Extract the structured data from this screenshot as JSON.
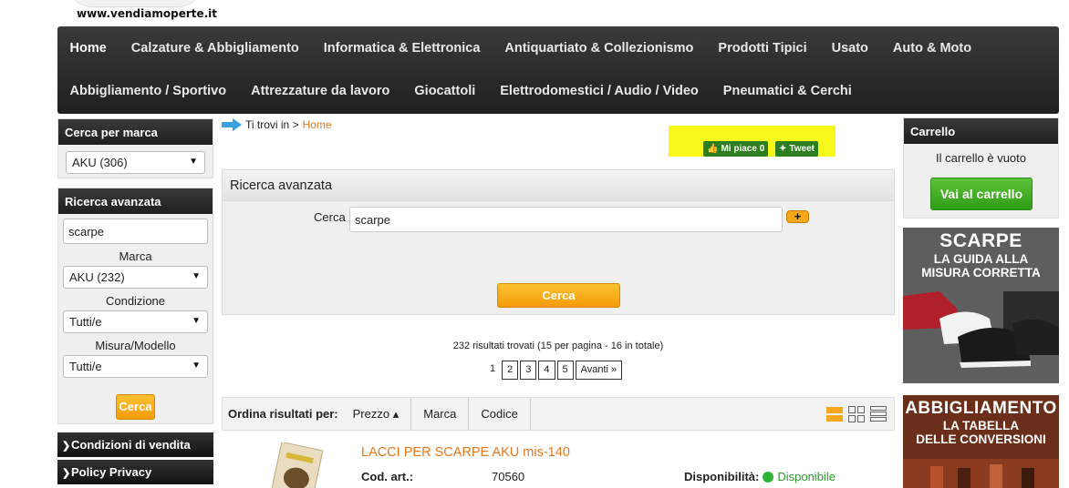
{
  "site": {
    "url": "www.vendiamoperte.it"
  },
  "nav": {
    "row1": [
      "Home",
      "Calzature & Abbigliamento",
      "Informatica & Elettronica",
      "Antiquartiato & Collezionismo",
      "Prodotti Tipici",
      "Usato",
      "Auto & Moto"
    ],
    "row2": [
      "Abbigliamento / Sportivo",
      "Attrezzature da lavoro",
      "Giocattoli",
      "Elettrodomestici / Audio / Video",
      "Pneumatici & Cerchi"
    ]
  },
  "brand_box": {
    "title": "Cerca per marca",
    "selected": "AKU (306)"
  },
  "adv_side": {
    "title": "Ricerca avanzata",
    "query": "scarpe",
    "marca_label": "Marca",
    "marca_value": "AKU (232)",
    "condizione_label": "Condizione",
    "condizione_value": "Tutti/e",
    "misura_label": "Misura/Modello",
    "misura_value": "Tutti/e",
    "button": "Cerca"
  },
  "side_links": [
    "Condizioni di vendita",
    "Policy Privacy"
  ],
  "breadcrumb": {
    "prefix": "Ti trovi in >",
    "current": "Home"
  },
  "social": {
    "like": "Mi piace 0",
    "tweet": "Tweet"
  },
  "adv_main": {
    "title": "Ricerca avanzata",
    "label": "Cerca",
    "value": "scarpe",
    "plus": "+",
    "button": "Cerca"
  },
  "results": {
    "summary": "232 risultati trovati (15 per pagina - 16 in totale)",
    "pages": [
      "1",
      "2",
      "3",
      "4",
      "5",
      "Avanti »"
    ]
  },
  "sort": {
    "label": "Ordina risultati per:",
    "options": [
      "Prezzo ▴",
      "Marca",
      "Codice"
    ]
  },
  "product": {
    "title": "LACCI PER SCARPE AKU mis-140",
    "code_label": "Cod. art.:",
    "code_value": "70560",
    "avail_label": "Disponibilità:",
    "avail_value": "Disponibile"
  },
  "cart": {
    "title": "Carrello",
    "empty": "Il carrello è vuoto",
    "button": "Vai al carrello"
  },
  "banners": [
    {
      "big": "SCARPE",
      "line1": "LA GUIDA  ALLA",
      "line2": "MISURA CORRETTA"
    },
    {
      "big": "ABBIGLIAMENTO",
      "line1": "LA TABELLA",
      "line2": "DELLE CONVERSIONI"
    }
  ],
  "colors": {
    "accent": "#e8771c",
    "button_orange": "#f59b0a",
    "button_green": "#2f9c16",
    "nav_dark": "#1f1f1f"
  }
}
